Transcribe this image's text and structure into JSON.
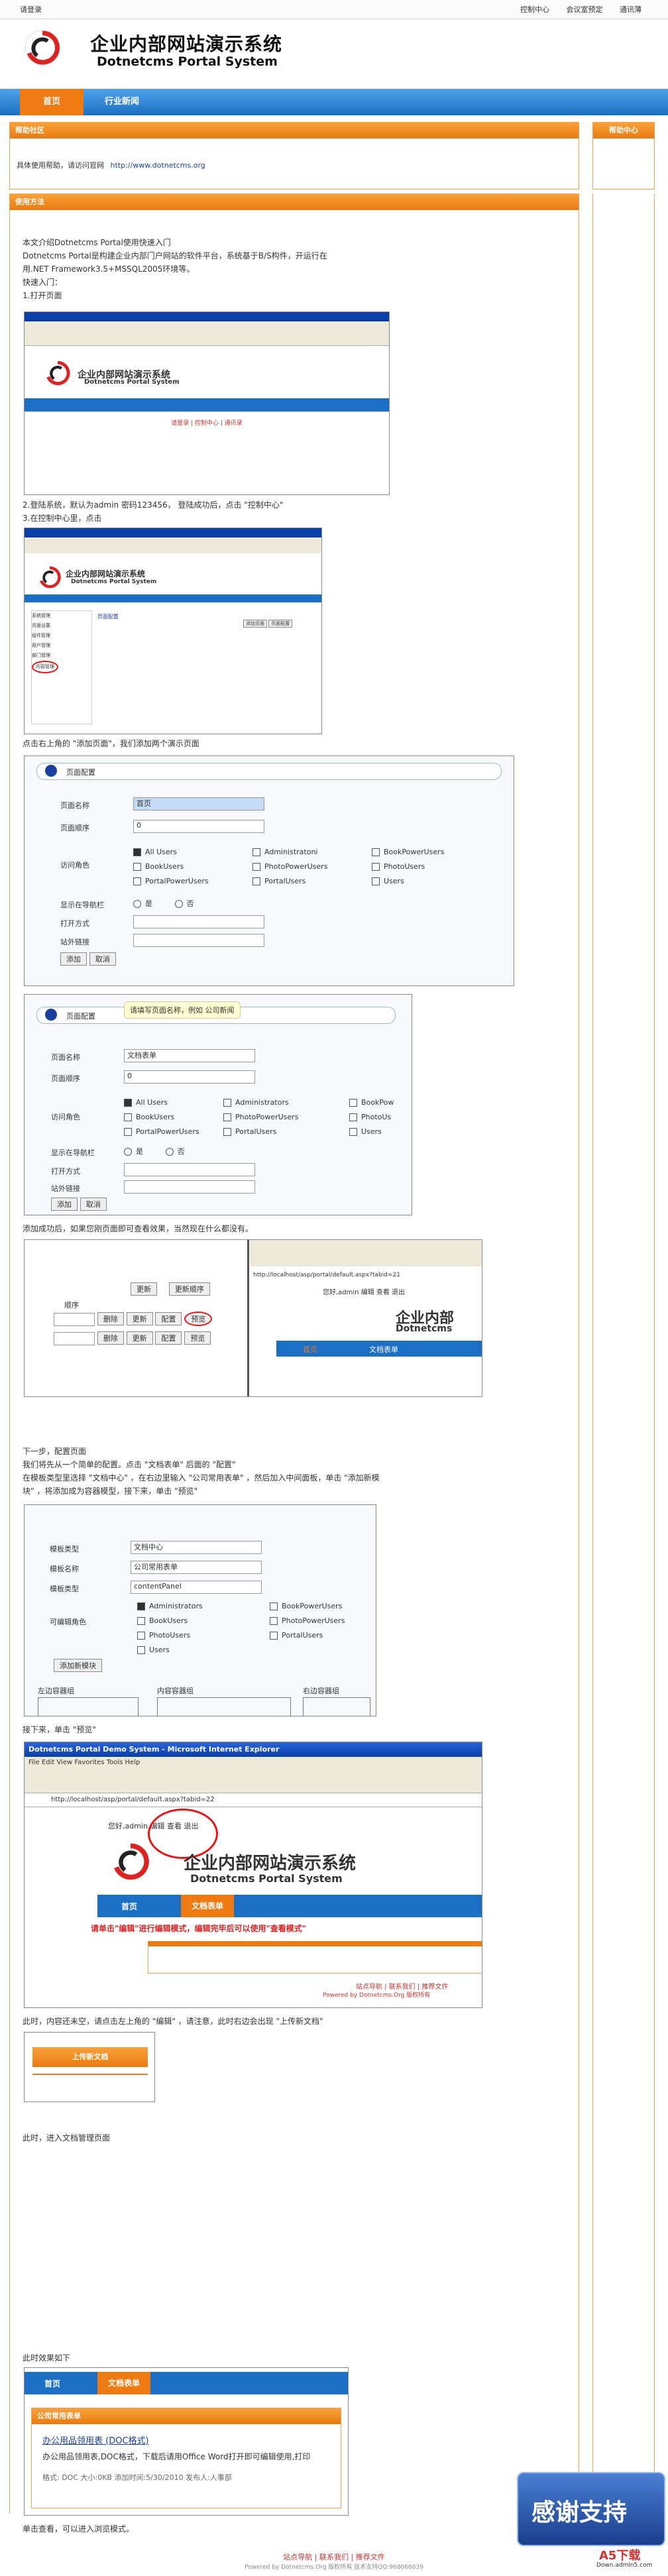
{
  "topbar": {
    "login": "请登录",
    "links": [
      "控制中心",
      "会议室预定",
      "通讯薄"
    ]
  },
  "logo": {
    "title": "企业内部网站演示系统",
    "subtitle": "Dotnetcms Portal System"
  },
  "nav": {
    "items": [
      "首页",
      "行业新闻"
    ]
  },
  "help_panel": {
    "title": "帮助社区",
    "text": "具体使用帮助，请访问官网",
    "link": "http://www.dotnetcms.org"
  },
  "side_panel": {
    "title": "帮助中心"
  },
  "guide_panel": {
    "title": "使用方法"
  },
  "guide": {
    "intro": [
      "本文介绍Dotnetcms Portal使用快速入门",
      "Dotnetcms Portal是构建企业内部门户网站的软件平台，系统基于B/S构件，开运行在",
      "用.NET Framework3.5+MSSQL2005环境等。",
      "快速入门：",
      "1.打开页面"
    ],
    "step2": [
      "2.登陆系统，默认为admin 密码123456，  登陆成功后，点击 \"控制中心\"",
      "3.在控制中心里，点击"
    ],
    "step_add_page": "点击右上角的 \"添加页面\"，我们添加两个演示页面",
    "step_add_done": "添加成功后，如果您刚页面即可查看效果，当然现在什么都没有。",
    "step_next": [
      "下一步，配置页面",
      "我们将先从一个简单的配置。点击 \"文档表单\" 后面的 \"配置\"",
      "在模板类型里选择 \"文档中心\" ，在右边里输入 \"公司常用表单\" ，然后加入中间面板，单击 \"添加新模",
      "块\" ，将添加成为容器模型，接下来，单击 \"预览\""
    ],
    "step_preview": "接下来，单击 \"预览\"",
    "step_edit": "此时，内容还未空，请点击左上角的 \"编辑\" ，请注意，此时右边会出现 \"上传新文档\"",
    "step_manage": "此时，进入文档管理页面",
    "step_effect": "此时效果如下",
    "step_view": "单击查看，可以进入浏览模式。"
  },
  "shot1": {
    "title": "企业内部网站演示系统",
    "subtitle": "Dotnetcms Portal System",
    "link": "请登录 | 控制中心 | 通讯录"
  },
  "shot2": {
    "title": "企业内部网站演示系统",
    "subtitle": "Dotnetcms Portal System",
    "tab": "页面配置",
    "menu": [
      "系统管理",
      "页面设置",
      "组件管理",
      "用户管理",
      "部门管理",
      "内容管理"
    ],
    "btns": [
      "添加页面",
      "页面配置"
    ]
  },
  "form1": {
    "title": "页面配置",
    "labels": [
      "页面名称",
      "页面顺序",
      "访问角色",
      "显示在导航栏",
      "打开方式",
      "站外链接"
    ],
    "name_value": "首页",
    "order_value": "0",
    "roles": [
      "All Users",
      "Administratoni",
      "BookPowerUsers",
      "BookUsers",
      "PhotoPowerUsers",
      "PhotoUsers",
      "PortalPowerUsers",
      "PortalUsers",
      "Users"
    ],
    "radio": [
      "是",
      "否"
    ],
    "buttons": [
      "添加",
      "取消"
    ]
  },
  "form2": {
    "title": "页面配置",
    "tooltip": "请填写页面名称，例如 公司新闻",
    "labels": [
      "页面名称",
      "页面顺序",
      "访问角色",
      "显示在导航栏",
      "打开方式",
      "站外链接"
    ],
    "name_value": "文档表单",
    "order_value": "0",
    "roles": [
      "All Users",
      "Administrators",
      "BookPow",
      "BookUsers",
      "PhotoPowerUsers",
      "PhotoUs",
      "PortalPowerUsers",
      "PortalUsers",
      "Users"
    ],
    "radio": [
      "是",
      "否"
    ],
    "buttons": [
      "添加",
      "取消"
    ]
  },
  "shot3": {
    "cols": [
      "顺序"
    ],
    "btns": [
      "删除",
      "更新",
      "配置",
      "预览"
    ],
    "top_btns": [
      "更新",
      "更新顺序"
    ],
    "address": "http://localhost/asp/portal/default.aspx?tabid=21",
    "nav": [
      "首页",
      "文档表单"
    ],
    "user": "您好,admin 编辑 查看 退出",
    "logo": "企业内部",
    "logo_sub": "Dotnetcms"
  },
  "form3": {
    "labels": [
      "模板类型",
      "模板名称",
      "模板类型",
      "可编辑角色"
    ],
    "values": [
      "文档中心",
      "公司常用表单",
      "contentPanel"
    ],
    "roles": [
      "Administrators",
      "BookPowerUsers",
      "BookUsers",
      "PhotoPowerUsers",
      "PhotoUsers",
      "PortalUsers",
      "Users"
    ],
    "button": "添加新模块",
    "panes": [
      "左边容器组",
      "内容容器组",
      "右边容器组"
    ]
  },
  "shot4": {
    "window_title": "Dotnetcms Portal Demo System - Microsoft Internet Explorer",
    "menu": "File  Edit  View  Favorites  Tools  Help",
    "address": "http://localhost/asp/portal/default.aspx?tabid=22",
    "user": "您好,admin 编辑 查看 退出",
    "title": "企业内部网站演示系统",
    "subtitle": "Dotnetcms Portal System",
    "nav": [
      "首页",
      "文档表单"
    ],
    "warning": "请单击\"编辑\"进行编辑模式，编辑完毕后可以使用\"查看模式\"",
    "footer": "站点导航 | 联系我们 | 推荐文件",
    "powered": "Powered by Dotnetcms.Org 版权所有"
  },
  "shot5": {
    "title": "上传新文档"
  },
  "shot6": {
    "nav": [
      "首页",
      "文档表单"
    ],
    "panel": "公司常用表单",
    "link": "办公用品领用表 (DOC格式)",
    "desc": "办公用品领用表,DOC格式，下载后请用Office Word打开即可编辑使用,打印",
    "meta": "格式: DOC  大小:0KB  添加时间:5/30/2010  发布人:人事部"
  },
  "footer": {
    "links": "站点导航 | 联系我们 | 推荐文件",
    "powered": "Powered by Dotnetcms.Org 版权所有 技术支持QQ:968066039"
  },
  "watermark": {
    "text": "感谢支持",
    "brand": "A5下载",
    "site": "Down.admin5.com"
  },
  "colors": {
    "orange": "#f07a12",
    "blue": "#1b6fc4"
  }
}
